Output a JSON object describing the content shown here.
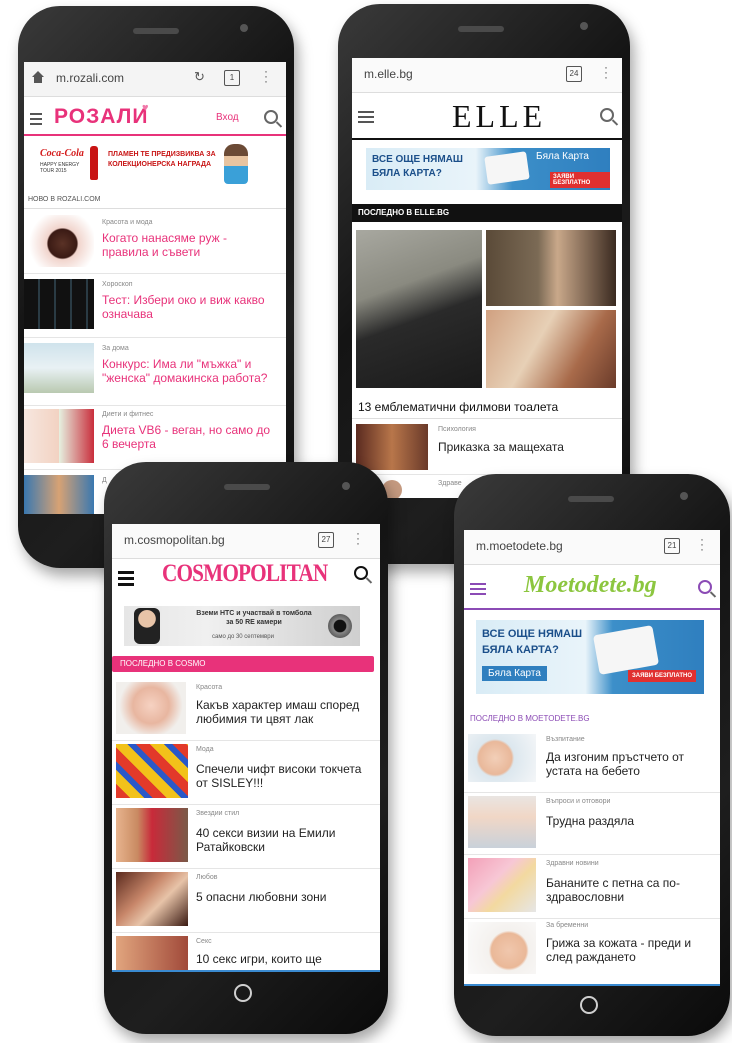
{
  "rozali": {
    "url": "m.rozali.com",
    "tab_count": "1",
    "logo": "РОЗАЛИ",
    "login": "Вход",
    "ad_text": "ПЛАМЕН ТЕ ПРЕДИЗВИКВА ЗА КОЛЕКЦИОНЕРСКА НАГРАДА",
    "ad_brand": "Coca-Cola",
    "ad_sub": "HAPPY ENERGY TOUR 2015",
    "section": "НОВО В ROZALI.COM",
    "articles": [
      {
        "category": "Красота и мода",
        "title": "Когато нанасяме руж - правила и съвети"
      },
      {
        "category": "Хороскоп",
        "title": "Тест: Избери око и виж какво означава"
      },
      {
        "category": "За дома",
        "title": "Конкурс: Има ли \"мъжка\" и \"женска\" домакинска работа?"
      },
      {
        "category": "Диети и фитнес",
        "title": "Диета VB6 - веган, но само до 6 вечерта"
      },
      {
        "category": "Д",
        "title": ""
      }
    ]
  },
  "elle": {
    "url": "m.elle.bg",
    "tab_count": "24",
    "logo": "ELLE",
    "ad_line1": "ВСЕ ОЩЕ НЯМАШ",
    "ad_line2": "БЯЛА КАРТА?",
    "ad_card": "Бяла Карта",
    "ad_button": "ЗАЯВИ БЕЗПЛАТНО",
    "section": "ПОСЛЕДНО В ELLE.BG",
    "featured_title": "13 емблематични филмови тоалета",
    "articles": [
      {
        "category": "Психология",
        "title": "Приказка за мащехата"
      },
      {
        "category": "Здраве",
        "title": ""
      }
    ]
  },
  "cosmo": {
    "url": "m.cosmopolitan.bg",
    "tab_count": "27",
    "logo": "COSMOPOLITAN",
    "ad_text": "Вземи HTC и участвай в томбола за 50 RE камери",
    "ad_sub": "само до 30 септември",
    "section": "ПОСЛЕДНО В COSMO",
    "articles": [
      {
        "category": "Красота",
        "title": "Какъв характер имаш според любимия ти цвят лак"
      },
      {
        "category": "Мода",
        "title": "Спечели чифт високи токчета от SISLEY!!!"
      },
      {
        "category": "Звездии стил",
        "title": "40 секси визии на Емили Ратайковски"
      },
      {
        "category": "Любов",
        "title": "5 опасни любовни зони"
      },
      {
        "category": "Секс",
        "title": "10 секс игри, които ще"
      }
    ]
  },
  "moetodete": {
    "url": "m.moetodete.bg",
    "tab_count": "21",
    "logo": "Moetodete.bg",
    "ad_line1": "ВСЕ ОЩЕ НЯМАШ",
    "ad_line2": "БЯЛА КАРТА?",
    "ad_card": "Бяла Карта",
    "ad_button": "ЗАЯВИ БЕЗПЛАТНО",
    "section": "ПОСЛЕДНО В MOETODETE.BG",
    "articles": [
      {
        "category": "Възпитание",
        "title": "Да изгоним пръстчето от устата на бебето"
      },
      {
        "category": "Въпроси и отговори",
        "title": "Трудна раздяла"
      },
      {
        "category": "Здравни новини",
        "title": "Бананите с петна са по-здравословни"
      },
      {
        "category": "За бременни",
        "title": "Грижа за кожата - преди и след раждането"
      }
    ]
  },
  "colors": {
    "rozali_pink": "#e8327a",
    "cosmo_pink": "#e8327a",
    "moetodete_purple": "#8b4bb5",
    "moetodete_green": "#8cc63f",
    "ad_blue": "#2f7fbf"
  }
}
